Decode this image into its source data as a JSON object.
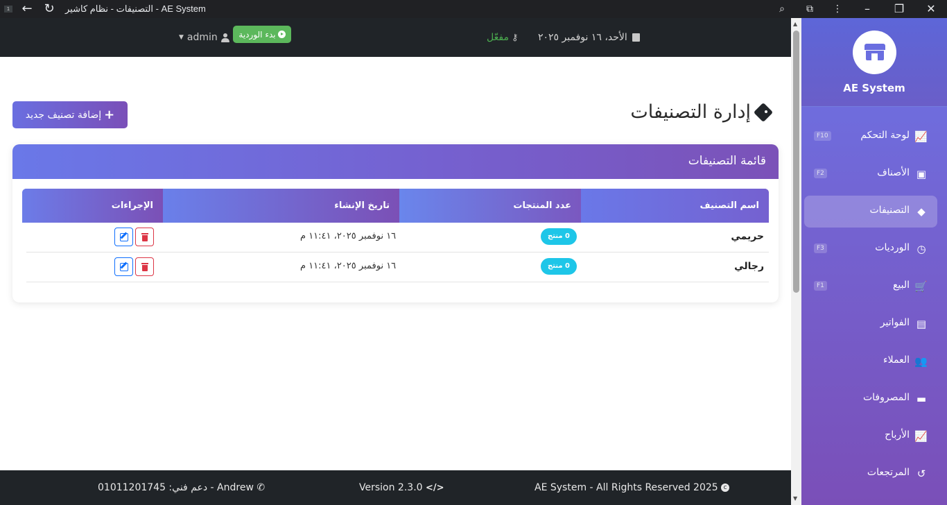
{
  "browser": {
    "title": "التصنيفات - نظام كاشير - AE System",
    "tab_badge": "1"
  },
  "header": {
    "date": "الأحد، ١٦ نوفمبر ٢٠٢٥",
    "status": "مفعّل",
    "shift_button": "بدء الوردية",
    "user": "admin"
  },
  "sidebar": {
    "brand": "AE System",
    "items": [
      {
        "label": "لوحة التحكم",
        "key": "F10",
        "icon": "chart-line-icon",
        "glyph": "📈"
      },
      {
        "label": "الأصناف",
        "key": "F2",
        "icon": "box-icon",
        "glyph": "▣"
      },
      {
        "label": "التصنيفات",
        "key": "",
        "icon": "tags-icon",
        "glyph": "◆"
      },
      {
        "label": "الورديات",
        "key": "F3",
        "icon": "clock-icon",
        "glyph": "◷"
      },
      {
        "label": "البيع",
        "key": "F1",
        "icon": "cart-icon",
        "glyph": "🛒"
      },
      {
        "label": "الفواتير",
        "key": "",
        "icon": "invoice-icon",
        "glyph": "▤"
      },
      {
        "label": "العملاء",
        "key": "",
        "icon": "users-icon",
        "glyph": "👥"
      },
      {
        "label": "المصروفات",
        "key": "",
        "icon": "money-icon",
        "glyph": "▬"
      },
      {
        "label": "الأرباح",
        "key": "",
        "icon": "chart-icon",
        "glyph": "📈"
      },
      {
        "label": "المرتجعات",
        "key": "",
        "icon": "undo-icon",
        "glyph": "↺"
      }
    ],
    "active_index": 2
  },
  "page": {
    "title": "إدارة التصنيفات",
    "add_button": "إضافة تصنيف جديد"
  },
  "card": {
    "title": "قائمة التصنيفات",
    "columns": [
      "اسم التصنيف",
      "عدد المنتجات",
      "تاريخ الإنشاء",
      "الإجراءات"
    ],
    "rows": [
      {
        "name": "حريمي",
        "count": "0 منتج",
        "date": "١٦ نوفمبر ٢٠٢٥، ١١:٤١ م"
      },
      {
        "name": "رجالي",
        "count": "0 منتج",
        "date": "١٦ نوفمبر ٢٠٢٥، ١١:٤١ م"
      }
    ]
  },
  "footer": {
    "rights": "AE System - All Rights Reserved 2025",
    "version": "Version 2.3.0",
    "support": "دعم فني: 01011201745 - Andrew"
  },
  "colors": {
    "accent_start": "#6a78e8",
    "accent_end": "#7b52b8",
    "header_bg": "#202428",
    "success": "#5cb85c",
    "badge": "#1ec6e8",
    "danger": "#dc3545",
    "primary": "#0d6efd"
  }
}
